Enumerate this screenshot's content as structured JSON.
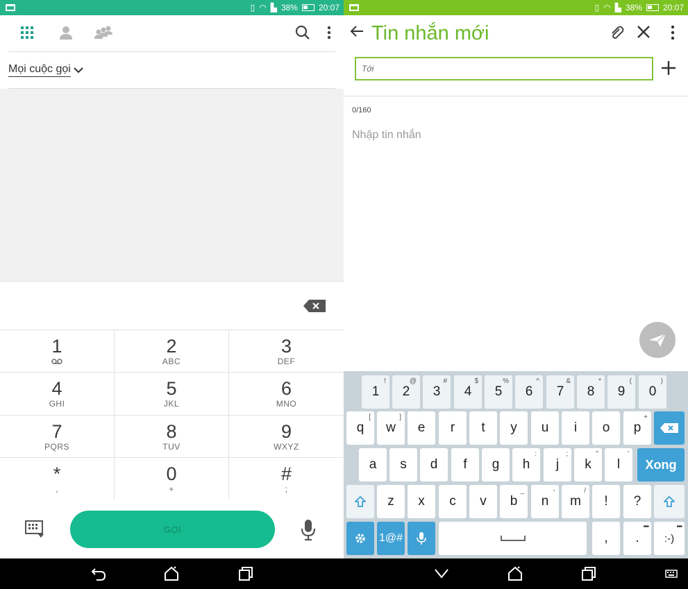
{
  "left": {
    "status": {
      "battery": "38%",
      "time": "20:07"
    },
    "filter_label": "Mọi cuộc gọi",
    "keys": [
      {
        "num": "1",
        "sub": ""
      },
      {
        "num": "2",
        "sub": "ABC"
      },
      {
        "num": "3",
        "sub": "DEF"
      },
      {
        "num": "4",
        "sub": "GHI"
      },
      {
        "num": "5",
        "sub": "JKL"
      },
      {
        "num": "6",
        "sub": "MNO"
      },
      {
        "num": "7",
        "sub": "PQRS"
      },
      {
        "num": "8",
        "sub": "TUV"
      },
      {
        "num": "9",
        "sub": "WXYZ"
      },
      {
        "num": "*",
        "sub": ","
      },
      {
        "num": "0",
        "sub": "+"
      },
      {
        "num": "#",
        "sub": ";"
      }
    ],
    "call_label": "GỌI"
  },
  "right": {
    "status": {
      "battery": "38%",
      "time": "20:07"
    },
    "title": "Tin nhắn mới",
    "to_placeholder": "Tới",
    "char_count": "0/160",
    "message_placeholder": "Nhập tin nhắn",
    "keyboard": {
      "row1": [
        [
          "1",
          "!"
        ],
        [
          "2",
          "@"
        ],
        [
          "3",
          "#"
        ],
        [
          "4",
          "$"
        ],
        [
          "5",
          "%"
        ],
        [
          "6",
          "^"
        ],
        [
          "7",
          "&"
        ],
        [
          "8",
          "*"
        ],
        [
          "9",
          "("
        ],
        [
          "0",
          ")"
        ]
      ],
      "row2": [
        [
          "q",
          "["
        ],
        [
          "w",
          "]"
        ],
        [
          "e",
          ""
        ],
        [
          "r",
          ""
        ],
        [
          "t",
          ""
        ],
        [
          "y",
          ""
        ],
        [
          "u",
          ""
        ],
        [
          "i",
          ""
        ],
        [
          "o",
          ""
        ],
        [
          "p",
          "+"
        ]
      ],
      "row3": [
        [
          "a",
          ""
        ],
        [
          "s",
          ""
        ],
        [
          "d",
          ""
        ],
        [
          "f",
          ""
        ],
        [
          "g",
          ""
        ],
        [
          "h",
          ":"
        ],
        [
          "j",
          ";"
        ],
        [
          "k",
          "\""
        ],
        [
          "l",
          "'"
        ]
      ],
      "row4": [
        [
          "z",
          ""
        ],
        [
          "x",
          ""
        ],
        [
          "c",
          ""
        ],
        [
          "v",
          ""
        ],
        [
          "b",
          "_"
        ],
        [
          "n",
          "-"
        ],
        [
          "m",
          "/"
        ],
        [
          "!",
          ""
        ],
        [
          "?",
          ""
        ]
      ],
      "done_label": "Xong",
      "symbols_label": "1@#",
      "comma_label": ",",
      "period_label": ".",
      "emoticon_label": ":-)"
    }
  },
  "colors": {
    "dialer_accent": "#26b58a",
    "messaging_accent": "#7cc322",
    "call_button": "#16bb8f",
    "keyboard_blue": "#3fa1d5"
  }
}
